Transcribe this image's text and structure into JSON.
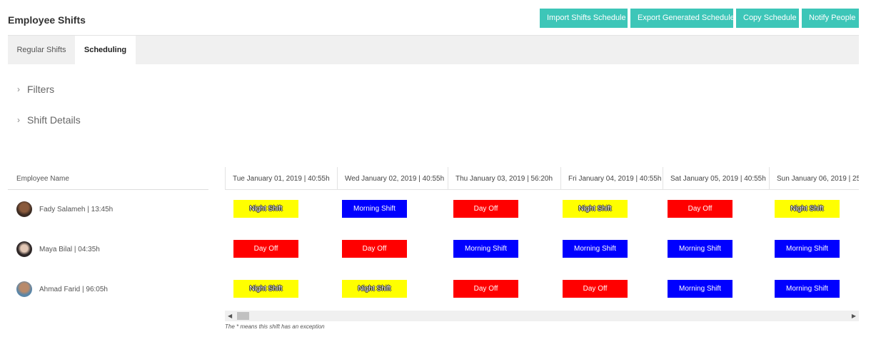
{
  "header": {
    "title": "Employee Shifts",
    "buttons": {
      "import": "Import Shifts Schedule",
      "export": "Export Generated Schedule",
      "copy": "Copy Schedule",
      "notify": "Notify People"
    }
  },
  "colors": {
    "accent": "#3dc6b8",
    "night_shift": "#ffff00",
    "morning_shift": "#0000ff",
    "day_off": "#ff0000"
  },
  "tabs": [
    {
      "label": "Regular Shifts",
      "active": false
    },
    {
      "label": "Scheduling",
      "active": true
    }
  ],
  "sections": {
    "filters": "Filters",
    "shift_details": "Shift Details"
  },
  "table": {
    "employee_header": "Employee Name",
    "dates": [
      "Tue January 01, 2019 | 40:55h",
      "Wed January 02, 2019 | 40:55h",
      "Thu January 03, 2019 | 56:20h",
      "Fri January 04, 2019 | 40:55h",
      "Sat January 05, 2019 | 40:55h",
      "Sun January 06, 2019 | 25"
    ],
    "employees": [
      {
        "name": "Fady Salameh | 13:45h",
        "avatar": "avatar-photo",
        "shifts": [
          "Night Shift",
          "Morning Shift",
          "Day Off",
          "Night Shift",
          "Day Off",
          "Night Shift"
        ]
      },
      {
        "name": "Maya Bilal | 04:35h",
        "avatar": "avatar-photo",
        "shifts": [
          "Day Off",
          "Day Off",
          "Morning Shift",
          "Morning Shift",
          "Morning Shift",
          "Morning Shift"
        ]
      },
      {
        "name": "Ahmad Farid | 96:05h",
        "avatar": "avatar-photo",
        "shifts": [
          "Night Shift",
          "Night Shift",
          "Day Off",
          "Day Off",
          "Morning Shift",
          "Morning Shift"
        ]
      }
    ]
  },
  "footnote": "The * means this shift has an exception",
  "icons": {
    "chevron": "›",
    "scroll_left": "◀",
    "scroll_right": "▶"
  }
}
